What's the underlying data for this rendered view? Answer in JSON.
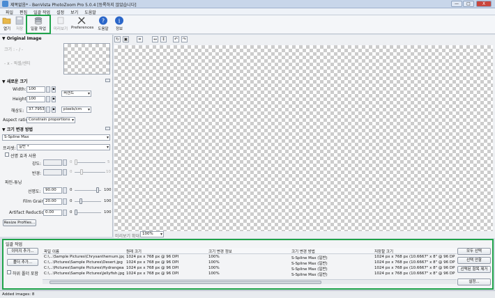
{
  "window": {
    "title": "제목없음* - BenVista PhotoZoom Pro 5.0.4 [등록하지 않았습니다]",
    "controls": [
      "—",
      "□",
      "X"
    ]
  },
  "menu": [
    "파일",
    "편집",
    "일괄 작업",
    "설정",
    "보기",
    "도움말"
  ],
  "toolbar": {
    "open": "열기",
    "save": "저장",
    "batch": "일괄 작업",
    "preview": "미리보기",
    "preferences": "Preferences",
    "help": "도움말",
    "info": "정보"
  },
  "left": {
    "original_header": "▼ Original Image",
    "original_size_label": "크기 : - / -",
    "original_pixels_label": "- x - 픽셀/센티",
    "new_size_header": "▼ 새로운 크기",
    "width_label": "Width:",
    "width_value": "100",
    "height_label": "Height:",
    "height_value": "100",
    "unit_value": "퍼센트",
    "resolution_label": "해상도:",
    "resolution_value": "37.7953",
    "resolution_unit": "pixels/cm",
    "aspect_label": "Aspect ratio:",
    "aspect_value": "Constrain proportions",
    "method_header": "▼ 크기 변경 방법",
    "method_value": "S-Spline Max",
    "profile_label": "프리셋:",
    "profile_value": "일반 *",
    "unsharp_label": "선명 효과 사용",
    "strength_label": "강도:",
    "strength_value": "0",
    "strength_min": "0",
    "strength_max": "5",
    "radius_label": "반경:",
    "radius_value": "0",
    "radius_min": "0",
    "radius_max": "10",
    "finetune_label": "파인-튜닝",
    "sharpness_label": "선명도:",
    "sharpness_value": "90.00",
    "sharpness_min": "0",
    "sharpness_max": "100",
    "sharpness_level": 0.9,
    "grain_label": "Film Grain:",
    "grain_value": "20.00",
    "grain_min": "0",
    "grain_max": "100",
    "grain_level": 0.2,
    "artifact_label": "Artifact Reduction:",
    "artifact_value": "0.00",
    "artifact_min": "0",
    "artifact_max": "100",
    "artifact_level": 0.0,
    "resize_profiles_button": "Resize Profiles..."
  },
  "canvas": {
    "zoom_label": "미리보기 확대",
    "zoom_value": "100%"
  },
  "batch": {
    "title": "일괄 작업",
    "add_images_button": "이미지 추가...",
    "add_folder_button": "폴더 추가...",
    "include_subfolders_label": "하위 폴더 포함",
    "columns": [
      "파일 이름",
      "원래 크기",
      "크기 변경 정보",
      "크기 변경 방법",
      "저장할 크기"
    ],
    "rows": [
      [
        "C:\\...\\Sample Pictures\\Chrysanthemum.jpg",
        "1024 px x 768 px @ 96 DPI",
        "100%",
        "S-Spline Max (일반)",
        "1024 px x 768 px (10.6667\" x 8\" @ 96 DPI"
      ],
      [
        "C:\\...\\Pictures\\Sample Pictures\\Desert.jpg",
        "1024 px x 768 px @ 96 DPI",
        "100%",
        "S-Spline Max (일반)",
        "1024 px x 768 px (10.6667\" x 8\" @ 96 DPI"
      ],
      [
        "C:\\...\\Pictures\\Sample Pictures\\Hydrangeas.jpg",
        "1024 px x 768 px @ 96 DPI",
        "100%",
        "S-Spline Max (일반)",
        "1024 px x 768 px (10.6667\" x 8\" @ 96 DPI"
      ],
      [
        "C:\\...\\Pictures\\Sample Pictures\\Jellyfish.jpg",
        "1024 px x 768 px @ 96 DPI",
        "100%",
        "S-Spline Max (일반)",
        "1024 px x 768 px (10.6667\" x 8\" @ 96 DPI"
      ]
    ],
    "select_all_button": "모두 선택",
    "select_none_button": "선택 안함",
    "remove_selected_button": "선택된 항목 제거",
    "settings_button": "설정..."
  },
  "status": {
    "text": "Added images: 8"
  },
  "colors": {
    "highlight": "#1fa34a",
    "help_icon": "#2a66c9"
  }
}
